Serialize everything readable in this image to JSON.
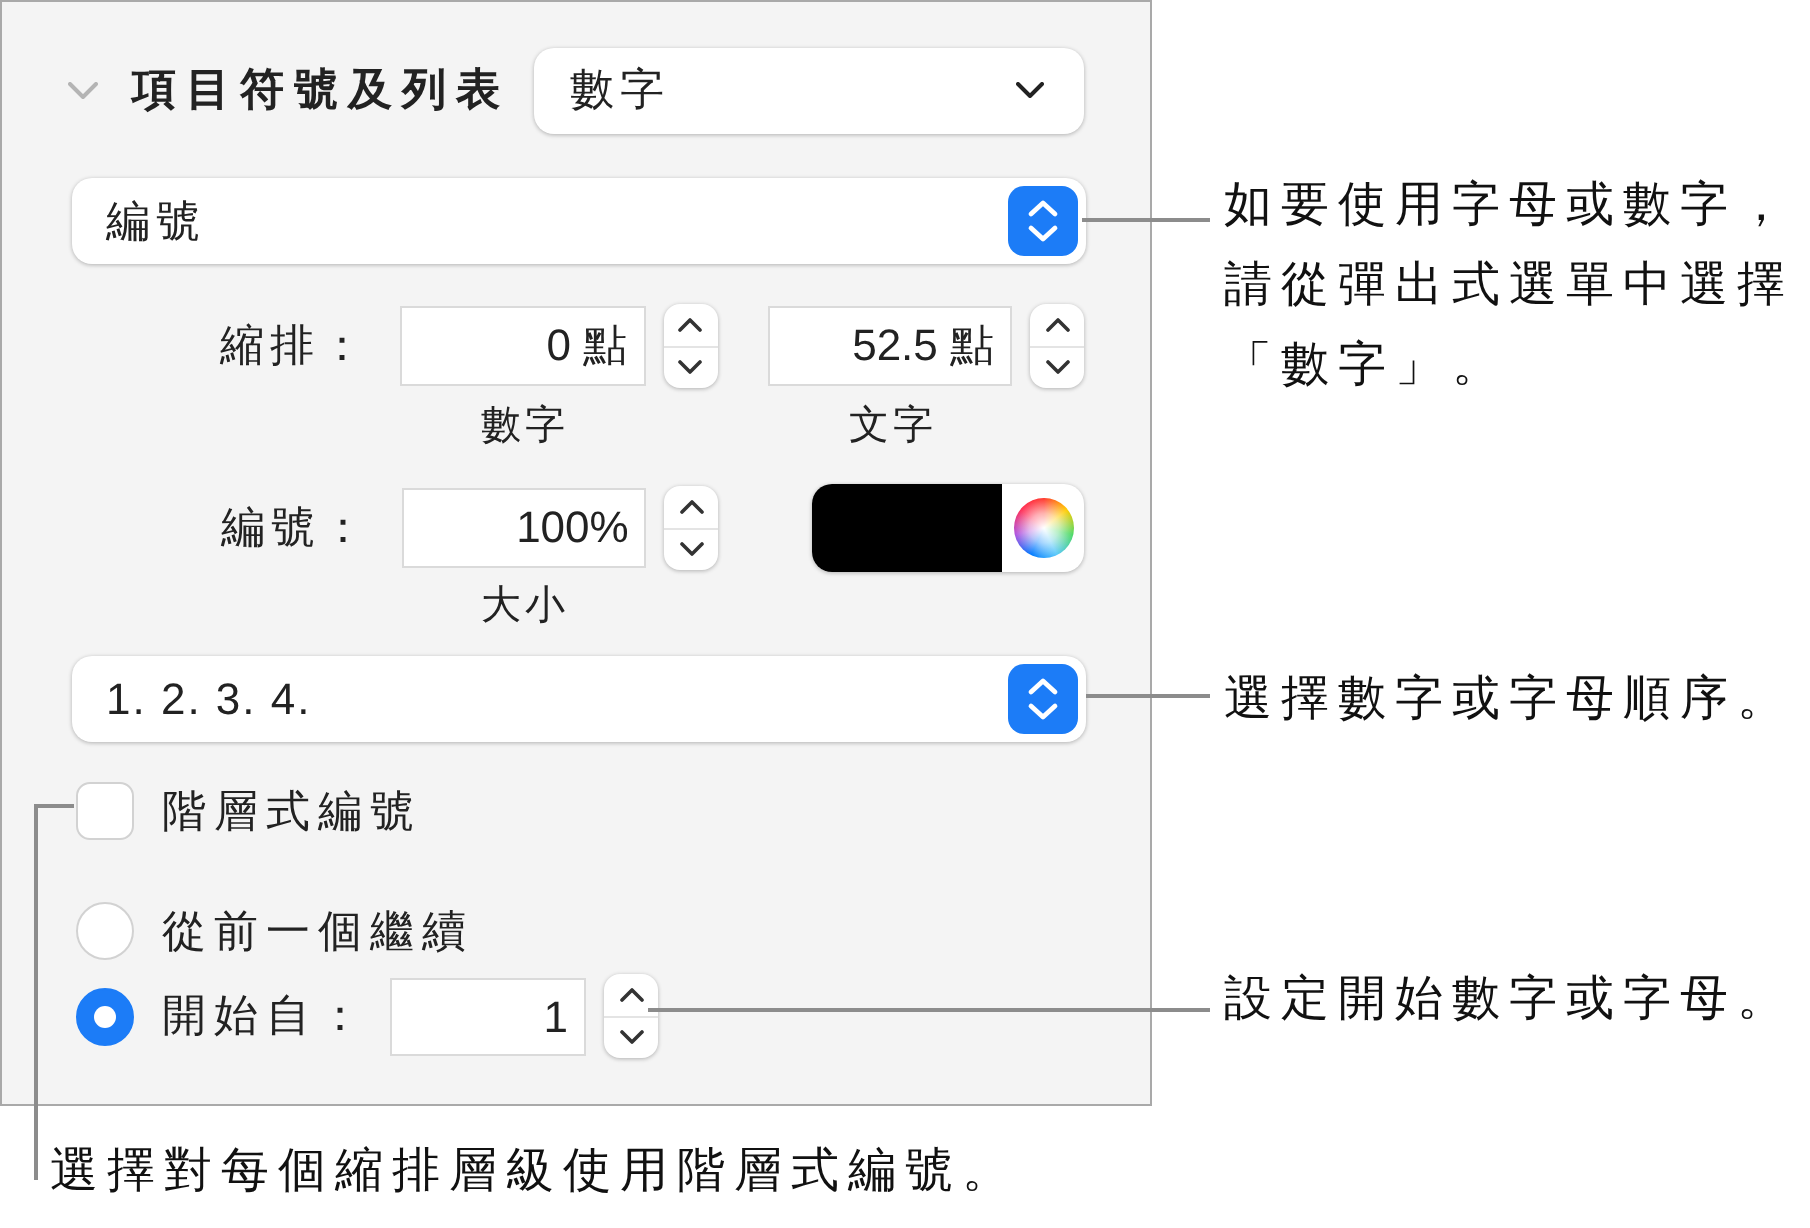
{
  "section": {
    "title": "項目符號及列表",
    "expanded": true,
    "style_menu": {
      "value": "數字"
    }
  },
  "list_type_popup": {
    "value": "編號"
  },
  "indent": {
    "label": "縮排：",
    "fields": [
      {
        "value": "0 點",
        "caption": "數字"
      },
      {
        "value": "52.5 點",
        "caption": "文字"
      }
    ]
  },
  "number_size": {
    "label": "編號：",
    "value": "100%",
    "caption": "大小",
    "color": "#000000"
  },
  "sequence_popup": {
    "value": "1. 2. 3. 4."
  },
  "tiered_numbers": {
    "label": "階層式編號",
    "checked": false
  },
  "numbering_options": [
    {
      "label": "從前一個繼續",
      "selected": false
    },
    {
      "label": "開始自：",
      "selected": true,
      "value": "1"
    }
  ],
  "callouts": [
    {
      "text": "如要使用字母或數字，請從彈出式選單中選擇「數字」。"
    },
    {
      "text": "選擇數字或字母順序。"
    },
    {
      "text": "設定開始數字或字母。"
    }
  ],
  "bottom_callout": {
    "text": "選擇對每個縮排層級使用階層式編號。"
  }
}
